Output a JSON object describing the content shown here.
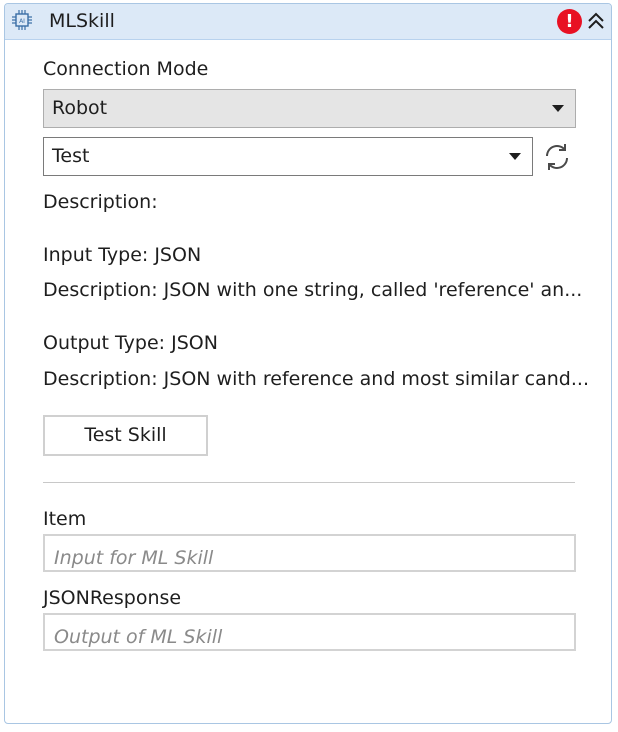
{
  "header": {
    "title": "MLSkill",
    "activity_icon": "ml-chip-icon",
    "error_icon": "error-icon",
    "collapse_icon": "double-chevron-up-icon"
  },
  "connection": {
    "label": "Connection Mode",
    "mode_value": "Robot",
    "skill_value": "Test",
    "refresh_icon": "refresh-icon"
  },
  "info": {
    "description_label": "Description:",
    "input_type": "Input Type:  JSON",
    "input_description": "Description:  JSON with one string, called 'reference' an...",
    "output_type": "Output Type:  JSON",
    "output_description": "Description:  JSON with reference and most similar cand..."
  },
  "test_button_label": "Test Skill",
  "item": {
    "label": "Item",
    "value": "",
    "placeholder": "Input for ML Skill"
  },
  "json_response": {
    "label": "JSONResponse",
    "value": "",
    "placeholder": "Output of ML Skill"
  },
  "colors": {
    "header_bg": "#dce9f7",
    "border": "#a9c6e3",
    "error": "#e81123",
    "combo_bg": "#e5e5e5"
  }
}
